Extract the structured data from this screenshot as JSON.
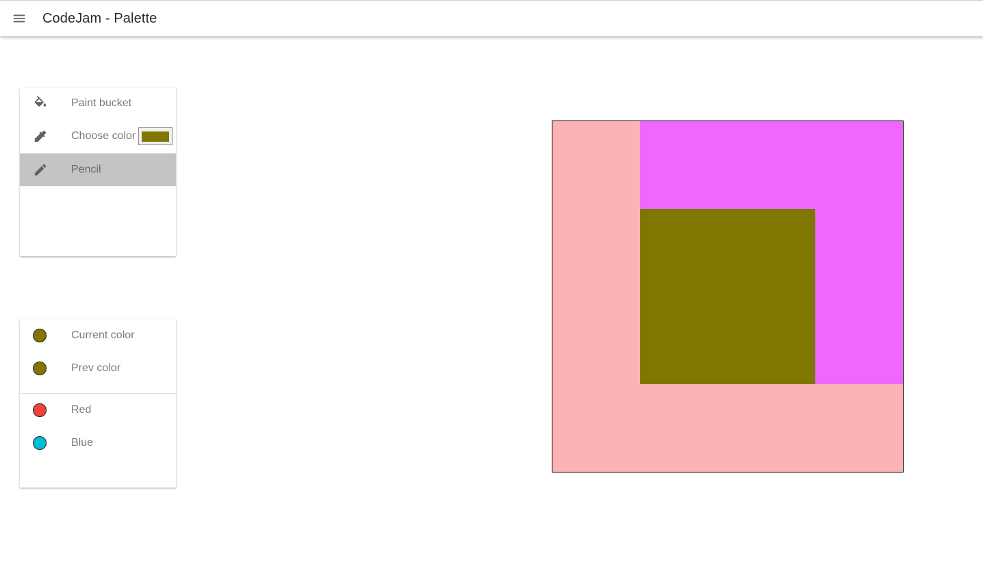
{
  "appbar": {
    "title": "CodeJam - Palette",
    "menu_icon": "menu-icon"
  },
  "tools": [
    {
      "label": "Paint bucket",
      "icon": "paint-bucket-icon",
      "active": false
    },
    {
      "label": "Choose color",
      "icon": "eyedropper-icon",
      "active": false,
      "swatch_color": "#807700"
    },
    {
      "label": "Pencil",
      "icon": "pencil-icon",
      "active": true
    }
  ],
  "colors": {
    "current": {
      "label": "Current color",
      "color": "#807700"
    },
    "prev": {
      "label": "Prev color",
      "color": "#807700"
    },
    "presets": [
      {
        "label": "Red",
        "color": "#f44336"
      },
      {
        "label": "Blue",
        "color": "#00bcd4"
      }
    ]
  },
  "canvas": {
    "grid_size": 4,
    "cells": [
      [
        "#fbb3b3",
        "#ef67fd",
        "#ef67fd",
        "#ef67fd"
      ],
      [
        "#fbb3b3",
        "#807700",
        "#807700",
        "#ef67fd"
      ],
      [
        "#fbb3b3",
        "#807700",
        "#807700",
        "#ef67fd"
      ],
      [
        "#fbb3b3",
        "#fbb3b3",
        "#fbb3b3",
        "#fbb3b3"
      ]
    ]
  }
}
